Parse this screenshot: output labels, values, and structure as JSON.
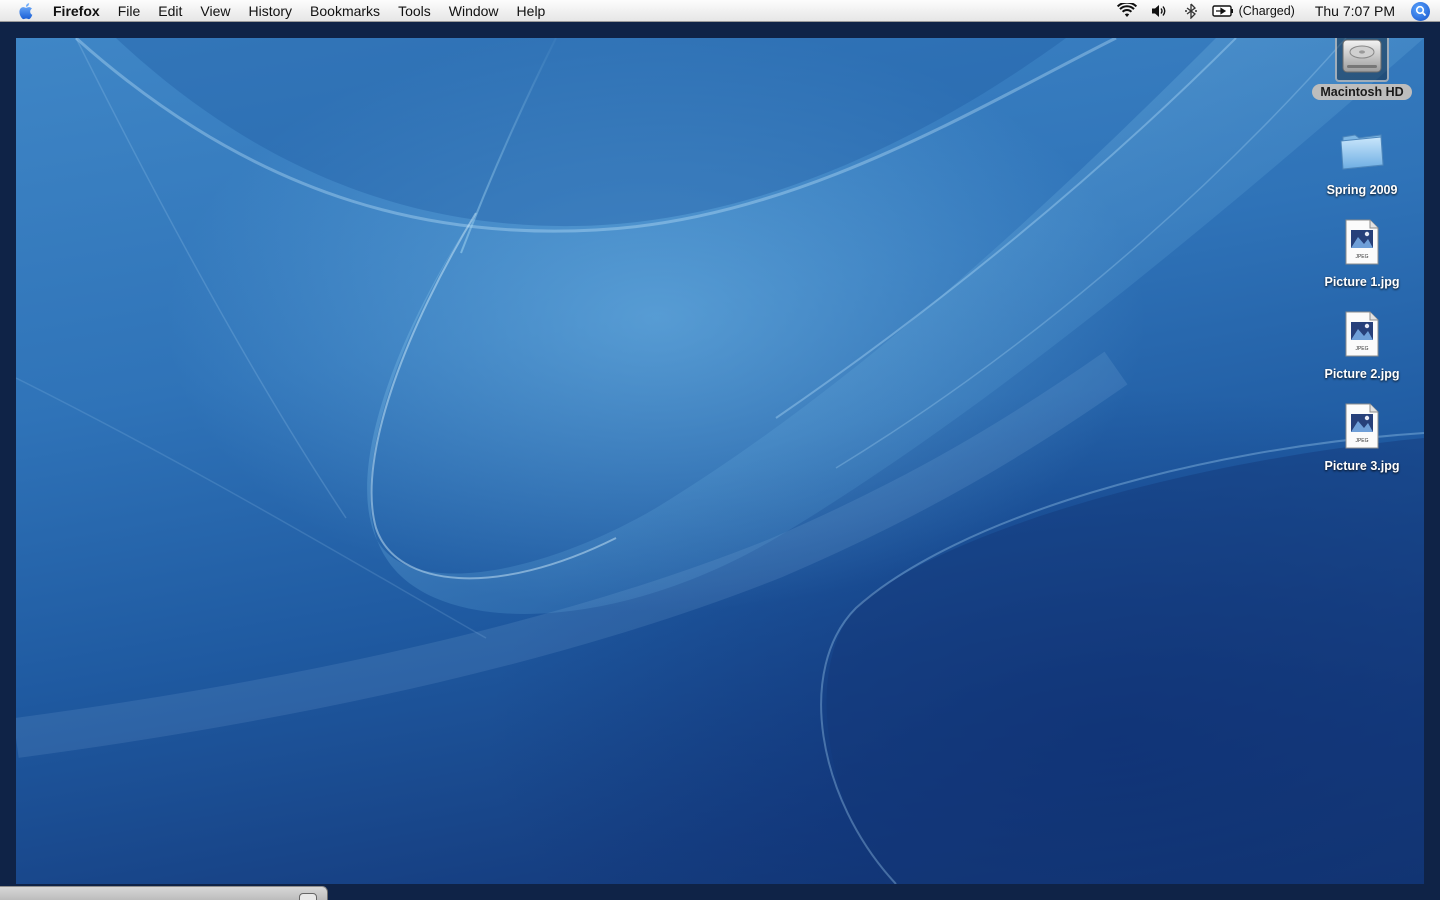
{
  "menubar": {
    "apple_icon": "apple-logo-icon",
    "app_name": "Firefox",
    "items": [
      "File",
      "Edit",
      "View",
      "History",
      "Bookmarks",
      "Tools",
      "Window",
      "Help"
    ],
    "status": {
      "wifi_icon": "wifi-icon",
      "volume_icon": "volume-icon",
      "bluetooth_icon": "bluetooth-icon",
      "battery_icon": "battery-icon",
      "battery_text": "(Charged)",
      "clock": "Thu 7:07 PM",
      "spotlight_icon": "spotlight-search-icon"
    }
  },
  "desktop": {
    "icons": [
      {
        "label": "Macintosh HD",
        "icon": "hard-drive-icon",
        "selected": true
      },
      {
        "label": "Spring 2009",
        "icon": "folder-icon",
        "selected": false
      },
      {
        "label": "Picture 1.jpg",
        "icon": "jpeg-file-icon",
        "selected": false
      },
      {
        "label": "Picture 2.jpg",
        "icon": "jpeg-file-icon",
        "selected": false
      },
      {
        "label": "Picture 3.jpg",
        "icon": "jpeg-file-icon",
        "selected": false
      }
    ],
    "jpeg_badge": "JPEG"
  },
  "colors": {
    "wallpaper_light": "#5ea9d9",
    "wallpaper_dark": "#12356f",
    "menubar": "#f2f2f2",
    "selection_label": "#bdbdbd"
  }
}
